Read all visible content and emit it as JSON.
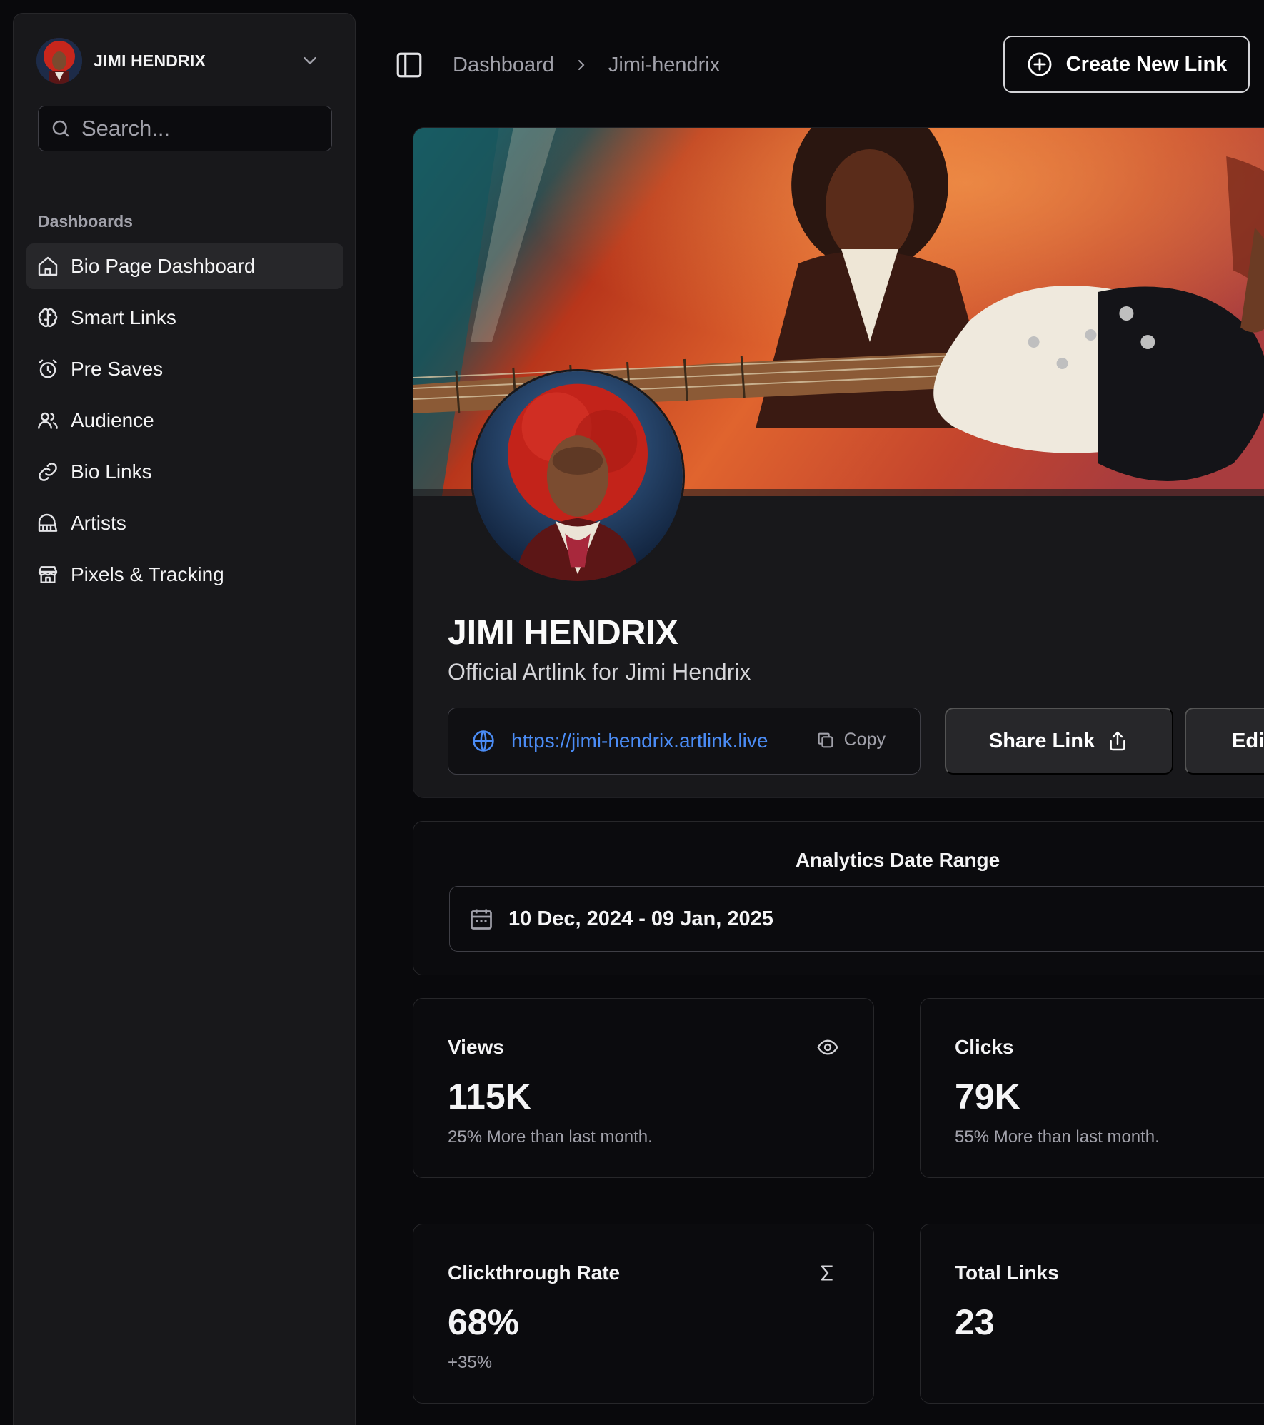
{
  "account": {
    "name": "JIMI HENDRIX"
  },
  "search": {
    "placeholder": "Search..."
  },
  "sidebar": {
    "section_label": "Dashboards",
    "items": [
      {
        "label": "Bio Page Dashboard",
        "icon": "home-icon",
        "active": true
      },
      {
        "label": "Smart Links",
        "icon": "brain-icon"
      },
      {
        "label": "Pre Saves",
        "icon": "alarm-clock-icon"
      },
      {
        "label": "Audience",
        "icon": "users-icon"
      },
      {
        "label": "Bio Links",
        "icon": "link-icon"
      },
      {
        "label": "Artists",
        "icon": "piano-icon"
      },
      {
        "label": "Pixels & Tracking",
        "icon": "store-icon"
      }
    ]
  },
  "breadcrumb": {
    "items": [
      "Dashboard",
      "Jimi-hendrix"
    ]
  },
  "header": {
    "create_button": "Create New Link"
  },
  "profile": {
    "name": "JIMI HENDRIX",
    "tagline": "Official Artlink for Jimi Hendrix",
    "url": "https://jimi-hendrix.artlink.live",
    "copy_label": "Copy",
    "share_label": "Share Link",
    "edit_label": "Edit"
  },
  "analytics": {
    "title": "Analytics Date Range",
    "date_range": "10 Dec, 2024 - 09 Jan, 2025"
  },
  "stats": [
    {
      "label": "Views",
      "value": "115K",
      "note": "25% More than last month.",
      "icon": "eye-icon"
    },
    {
      "label": "Clicks",
      "value": "79K",
      "note": "55% More than last month."
    },
    {
      "label": "Clickthrough Rate",
      "value": "68%",
      "note": "+35%",
      "icon": "sigma-icon"
    },
    {
      "label": "Total Links",
      "value": "23",
      "note": ""
    }
  ],
  "colors": {
    "accent_link": "#4b8cf5",
    "background": "#09090c",
    "panel": "#18181b",
    "border": "#27272a"
  }
}
